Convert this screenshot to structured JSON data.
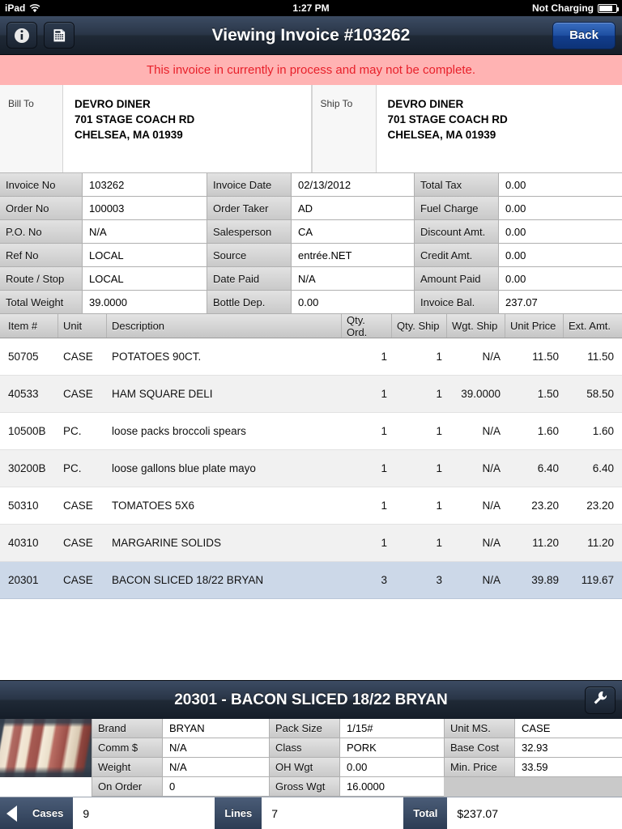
{
  "status_bar": {
    "device": "iPad",
    "wifi_icon": "wifi-icon",
    "time": "1:27 PM",
    "battery_text": "Not Charging",
    "battery_icon": "battery-icon"
  },
  "nav_bar": {
    "info_icon": "info-circle-icon",
    "calculator_icon": "calculator-icon",
    "title": "Viewing Invoice #103262",
    "back_label": "Back"
  },
  "warning": {
    "message": "This invoice in currently in process and may not be complete.",
    "background": "#ffb3b3",
    "text_color": "#e8202a"
  },
  "addresses": {
    "bill_to_label": "Bill To",
    "ship_to_label": "Ship To",
    "bill_to": {
      "name": "DEVRO DINER",
      "street": "701 STAGE COACH RD",
      "citystate": "CHELSEA, MA 01939"
    },
    "ship_to": {
      "name": "DEVRO DINER",
      "street": "701 STAGE COACH RD",
      "citystate": "CHELSEA, MA 01939"
    }
  },
  "info_grid": {
    "col1": [
      {
        "key": "Invoice No",
        "value": "103262"
      },
      {
        "key": "Order No",
        "value": "100003"
      },
      {
        "key": "P.O. No",
        "value": "N/A"
      },
      {
        "key": "Ref No",
        "value": "LOCAL"
      },
      {
        "key": "Route / Stop",
        "value": "LOCAL"
      },
      {
        "key": "Total Weight",
        "value": "39.0000"
      }
    ],
    "col2": [
      {
        "key": "Invoice Date",
        "value": "02/13/2012"
      },
      {
        "key": "Order Taker",
        "value": "AD"
      },
      {
        "key": "Salesperson",
        "value": "CA"
      },
      {
        "key": "Source",
        "value": "entrée.NET"
      },
      {
        "key": "Date Paid",
        "value": "N/A"
      },
      {
        "key": "Bottle Dep.",
        "value": "0.00"
      }
    ],
    "col3": [
      {
        "key": "Total Tax",
        "value": "0.00"
      },
      {
        "key": "Fuel Charge",
        "value": "0.00"
      },
      {
        "key": "Discount Amt.",
        "value": "0.00"
      },
      {
        "key": "Credit Amt.",
        "value": "0.00"
      },
      {
        "key": "Amount Paid",
        "value": "0.00"
      },
      {
        "key": "Invoice Bal.",
        "value": "237.07"
      }
    ]
  },
  "items_table": {
    "headers": {
      "item": "Item #",
      "unit": "Unit",
      "description": "Description",
      "qty_ord": "Qty. Ord.",
      "qty_ship": "Qty. Ship",
      "wgt_ship": "Wgt. Ship",
      "unit_price": "Unit Price",
      "ext_amt": "Ext. Amt."
    },
    "selected_color": "#ccd8e8",
    "rows": [
      {
        "item": "50705",
        "unit": "CASE",
        "description": "POTATOES 90CT.",
        "qty_ord": "1",
        "qty_ship": "1",
        "wgt_ship": "N/A",
        "unit_price": "11.50",
        "ext_amt": "11.50",
        "selected": false
      },
      {
        "item": "40533",
        "unit": "CASE",
        "description": "HAM SQUARE DELI",
        "qty_ord": "1",
        "qty_ship": "1",
        "wgt_ship": "39.0000",
        "unit_price": "1.50",
        "ext_amt": "58.50",
        "selected": false
      },
      {
        "item": "10500B",
        "unit": "PC.",
        "description": "loose packs broccoli spears",
        "qty_ord": "1",
        "qty_ship": "1",
        "wgt_ship": "N/A",
        "unit_price": "1.60",
        "ext_amt": "1.60",
        "selected": false
      },
      {
        "item": "30200B",
        "unit": "PC.",
        "description": "loose gallons blue plate mayo",
        "qty_ord": "1",
        "qty_ship": "1",
        "wgt_ship": "N/A",
        "unit_price": "6.40",
        "ext_amt": "6.40",
        "selected": false
      },
      {
        "item": "50310",
        "unit": "CASE",
        "description": "TOMATOES 5X6",
        "qty_ord": "1",
        "qty_ship": "1",
        "wgt_ship": "N/A",
        "unit_price": "23.20",
        "ext_amt": "23.20",
        "selected": false
      },
      {
        "item": "40310",
        "unit": "CASE",
        "description": "MARGARINE SOLIDS",
        "qty_ord": "1",
        "qty_ship": "1",
        "wgt_ship": "N/A",
        "unit_price": "11.20",
        "ext_amt": "11.20",
        "selected": false
      },
      {
        "item": "20301",
        "unit": "CASE",
        "description": "BACON SLICED 18/22 BRYAN",
        "qty_ord": "3",
        "qty_ship": "3",
        "wgt_ship": "N/A",
        "unit_price": "39.89",
        "ext_amt": "119.67",
        "selected": true
      }
    ]
  },
  "detail_panel": {
    "title": "20301 - BACON SLICED 18/22 BRYAN",
    "wrench_icon": "wrench-icon",
    "thumbnail": "bacon-product-photo",
    "col1": [
      {
        "key": "Brand",
        "value": "BRYAN"
      },
      {
        "key": "Comm $",
        "value": "N/A"
      },
      {
        "key": "Weight",
        "value": "N/A"
      },
      {
        "key": "On Order",
        "value": "0"
      }
    ],
    "col2": [
      {
        "key": "Pack Size",
        "value": "1/15#"
      },
      {
        "key": "Class",
        "value": "PORK"
      },
      {
        "key": "OH Wgt",
        "value": "0.00"
      },
      {
        "key": "Gross Wgt",
        "value": "16.0000"
      }
    ],
    "col3": [
      {
        "key": "Unit MS.",
        "value": "CASE"
      },
      {
        "key": "Base Cost",
        "value": "32.93"
      },
      {
        "key": "Min. Price",
        "value": "33.59"
      }
    ]
  },
  "toolbar": {
    "back_arrow_icon": "triangle-left-icon",
    "cases_label": "Cases",
    "cases_value": "9",
    "lines_label": "Lines",
    "lines_value": "7",
    "total_label": "Total",
    "total_value": "$237.07"
  }
}
